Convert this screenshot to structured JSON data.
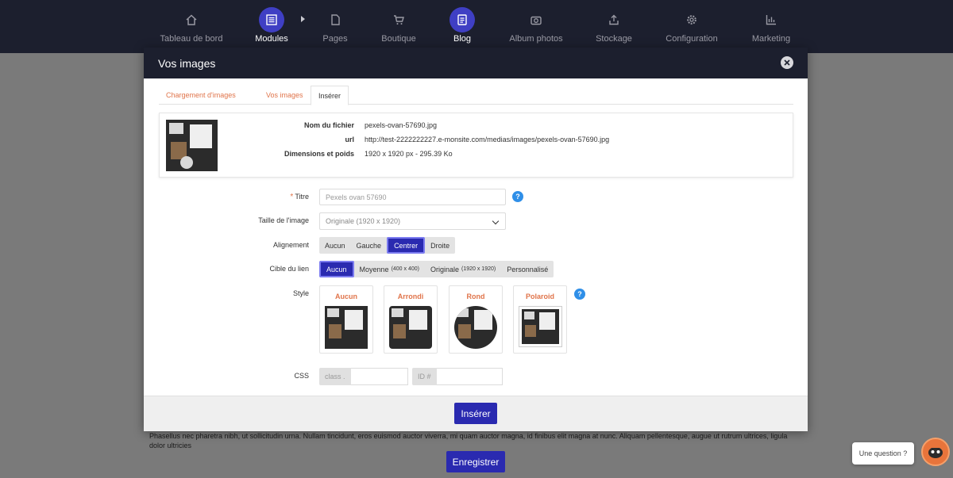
{
  "topnav": {
    "items": [
      {
        "label": "Tableau de bord",
        "icon": "home-icon"
      },
      {
        "label": "Modules",
        "icon": "modules-icon"
      },
      {
        "label": "Pages",
        "icon": "page-icon"
      },
      {
        "label": "Boutique",
        "icon": "cart-icon"
      },
      {
        "label": "Blog",
        "icon": "blog-icon"
      },
      {
        "label": "Album photos",
        "icon": "camera-icon"
      },
      {
        "label": "Stockage",
        "icon": "upload-icon"
      },
      {
        "label": "Configuration",
        "icon": "gear-icon"
      },
      {
        "label": "Marketing",
        "icon": "bar-chart-icon"
      }
    ],
    "active_bg_color": "#3f3fc4"
  },
  "modal": {
    "title": "Vos images",
    "tabs": [
      "Chargement d'images",
      "Vos images",
      "Insérer"
    ],
    "active_tab": "Insérer",
    "file": {
      "name_label": "Nom du fichier",
      "name": "pexels-ovan-57690.jpg",
      "url_label": "url",
      "url": "http://test-2222222227.e-monsite.com/medias/images/pexels-ovan-57690.jpg",
      "dims_label": "Dimensions et poids",
      "dims": "1920 x 1920 px - 295.39 Ko"
    },
    "form": {
      "title_label": "Titre",
      "title_required": "*",
      "title_placeholder": "Pexels ovan 57690",
      "size_label": "Taille de l'image",
      "size_value": "Originale (1920 x 1920)",
      "align_label": "Alignement",
      "align_options": [
        "Aucun",
        "Gauche",
        "Centrer",
        "Droite"
      ],
      "align_selected": "Centrer",
      "link_label": "Cible du lien",
      "link_options": [
        {
          "label": "Aucun",
          "detail": ""
        },
        {
          "label": "Moyenne",
          "detail": "(400 x 400)"
        },
        {
          "label": "Originale",
          "detail": "(1920 x 1920)"
        },
        {
          "label": "Personnalisé",
          "detail": ""
        }
      ],
      "link_selected": "Aucun",
      "style_label": "Style",
      "style_options": [
        "Aucun",
        "Arrondi",
        "Rond",
        "Polaroid"
      ],
      "css_label": "CSS",
      "css_class_prefix": "class .",
      "css_id_prefix": "ID #",
      "help_glyph": "?"
    },
    "insert_button": "Insérer",
    "accent_color": "#2a2ab0",
    "link_color": "#e0744a"
  },
  "background": {
    "text": "Phasellus nec pharetra nibh, ut sollicitudin urna. Nullam tincidunt, eros euismod auctor viverra, mi quam auctor magna, id finibus elit magna at nunc. Aliquam pellentesque, augue ut rutrum ultrices, ligula dolor ultricies",
    "save_button": "Enregistrer"
  },
  "help": {
    "question": "Une question ?"
  }
}
